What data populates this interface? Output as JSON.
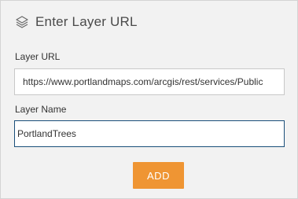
{
  "dialog": {
    "title": "Enter Layer URL",
    "icon": "layers-icon",
    "layer_url": {
      "label": "Layer URL",
      "value": "https://www.portlandmaps.com/arcgis/rest/services/Public"
    },
    "layer_name": {
      "label": "Layer Name",
      "value": "PortlandTrees"
    },
    "add_label": "ADD"
  },
  "colors": {
    "panel_bg": "#f2f2f2",
    "accent": "#ef9533",
    "focus_border": "#1a4f7a"
  }
}
